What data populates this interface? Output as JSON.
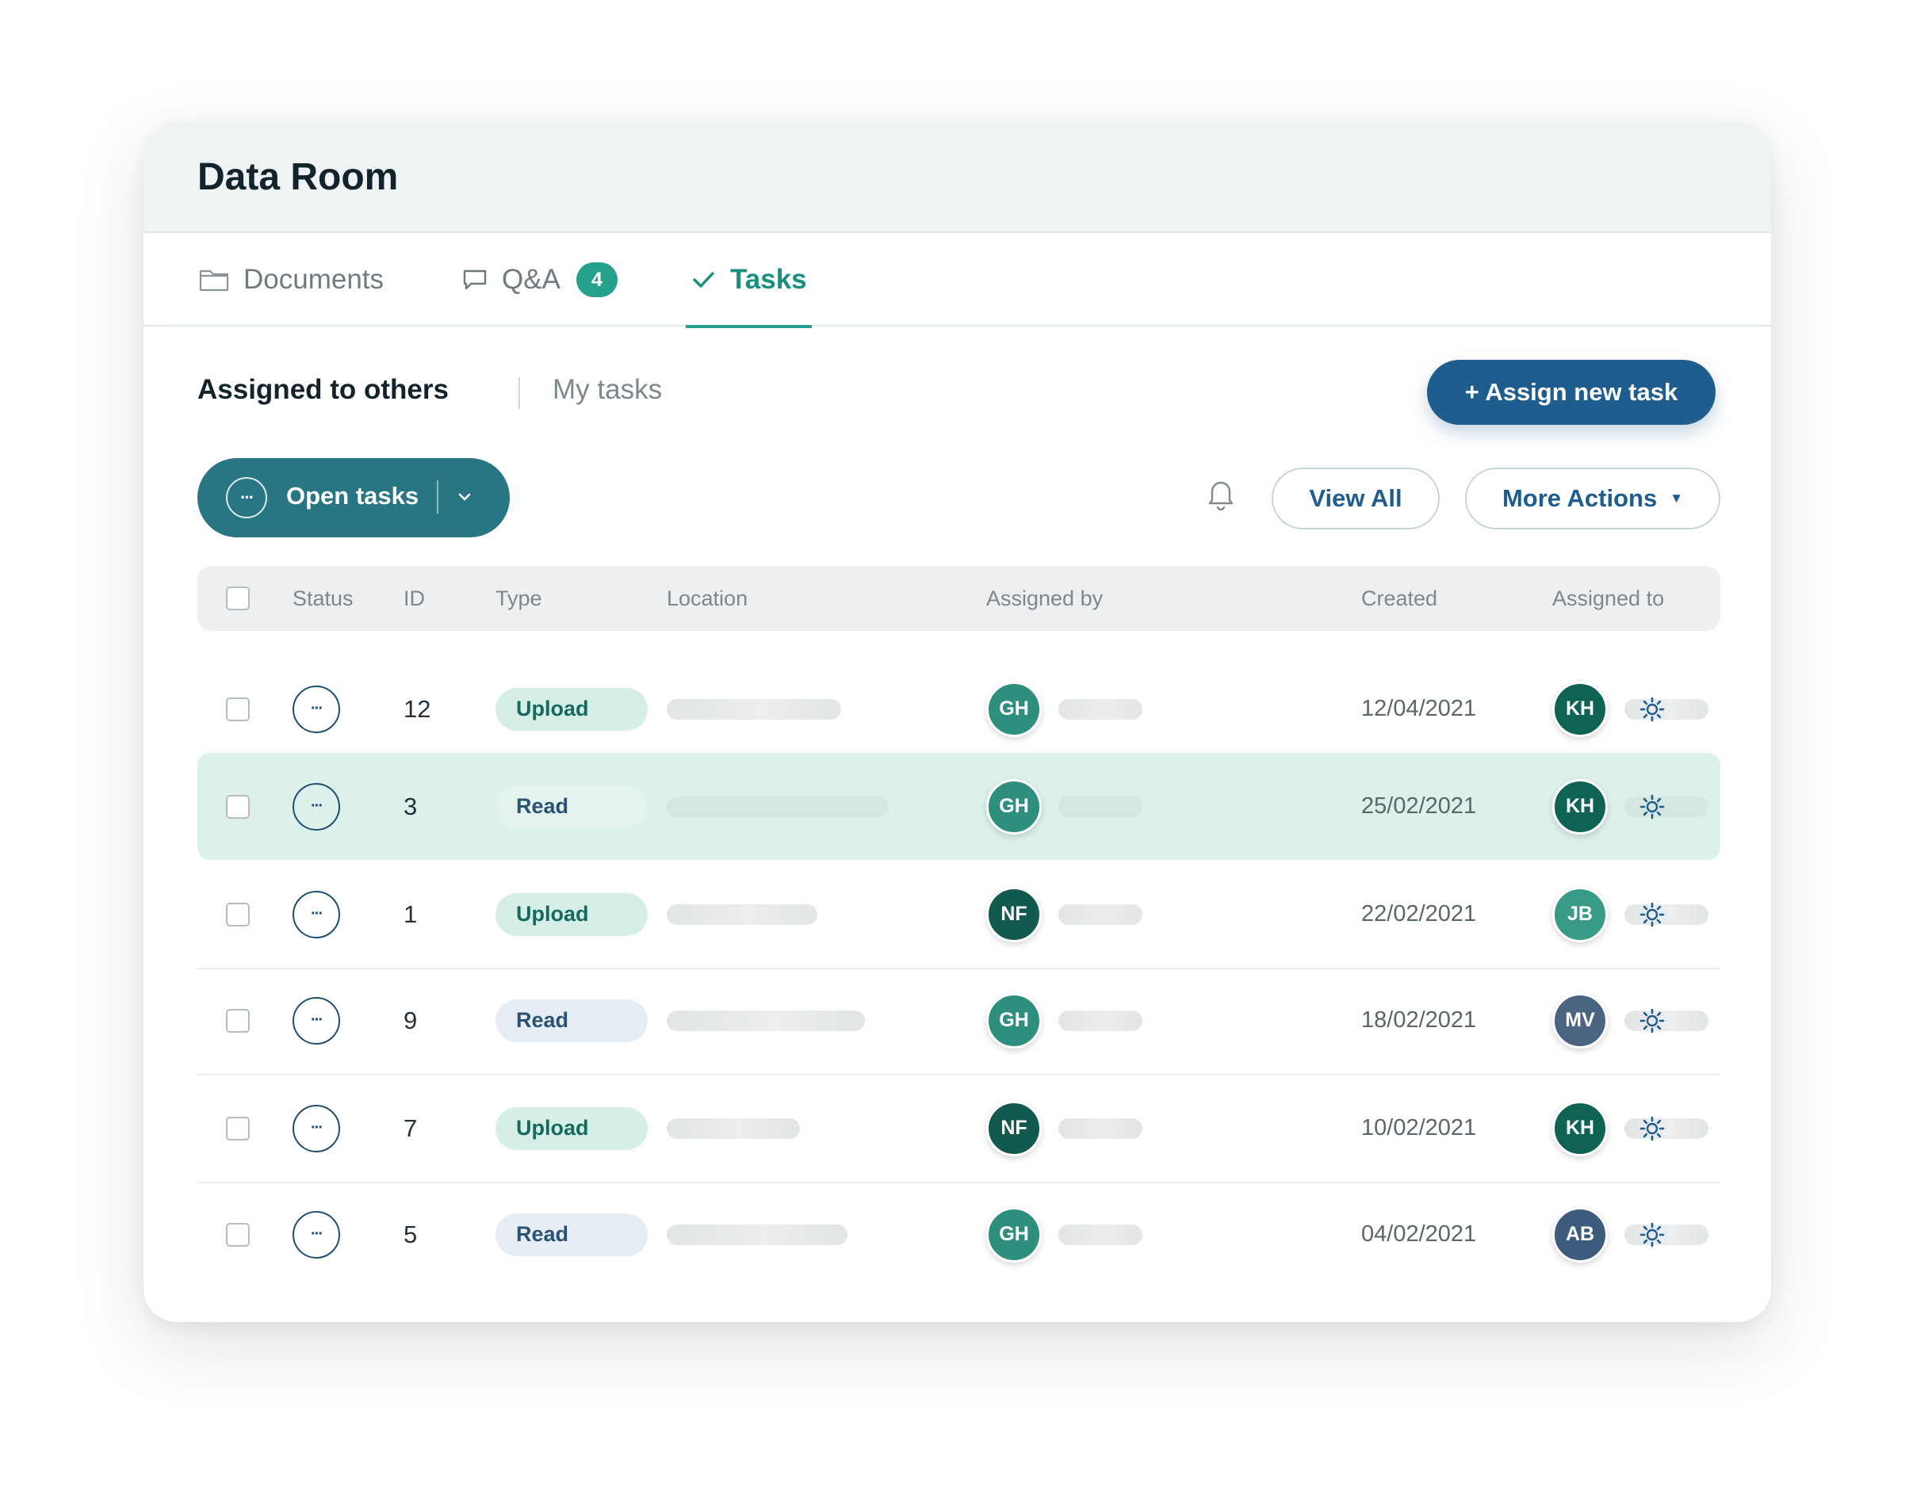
{
  "app": {
    "title": "Data Room"
  },
  "tabs": [
    {
      "label": "Documents",
      "icon": "folder-icon"
    },
    {
      "label": "Q&A",
      "icon": "chat-icon",
      "badge": "4"
    },
    {
      "label": "Tasks",
      "icon": "check-icon",
      "active": true
    }
  ],
  "subnav": {
    "assigned": "Assigned to others",
    "mine": "My tasks"
  },
  "actions": {
    "assign_label": "+ Assign new task",
    "filter_label": "Open tasks",
    "view_all": "View All",
    "more_actions": "More Actions",
    "more_caret": "▼"
  },
  "table": {
    "columns": [
      "Status",
      "ID",
      "Type",
      "Location",
      "Assigned by",
      "Created",
      "Assigned to"
    ],
    "rows": [
      {
        "id": "12",
        "type": "Upload",
        "by": "GH",
        "created": "12/04/2021",
        "to": "KH"
      },
      {
        "id": "3",
        "type": "Read",
        "by": "GH",
        "created": "25/02/2021",
        "to": "KH"
      },
      {
        "id": "1",
        "type": "Upload",
        "by": "NF",
        "created": "22/02/2021",
        "to": "JB"
      },
      {
        "id": "9",
        "type": "Read",
        "by": "GH",
        "created": "18/02/2021",
        "to": "MV"
      },
      {
        "id": "7",
        "type": "Upload",
        "by": "NF",
        "created": "10/02/2021",
        "to": "KH"
      },
      {
        "id": "5",
        "type": "Read",
        "by": "GH",
        "created": "04/02/2021",
        "to": "AB"
      }
    ],
    "status_glyph": "···"
  },
  "colors": {
    "accent_green": "#26a18d",
    "primary_blue": "#1f5d8f",
    "filter_teal": "#287583",
    "highlight_row": "#dcf1ea",
    "avatar_GH": "#2f8f7e",
    "avatar_KH": "#0f6352",
    "avatar_NF": "#125a4f",
    "avatar_JB": "#3a9a88",
    "avatar_MV": "#4a6481",
    "avatar_AB": "#3d5b7c"
  }
}
